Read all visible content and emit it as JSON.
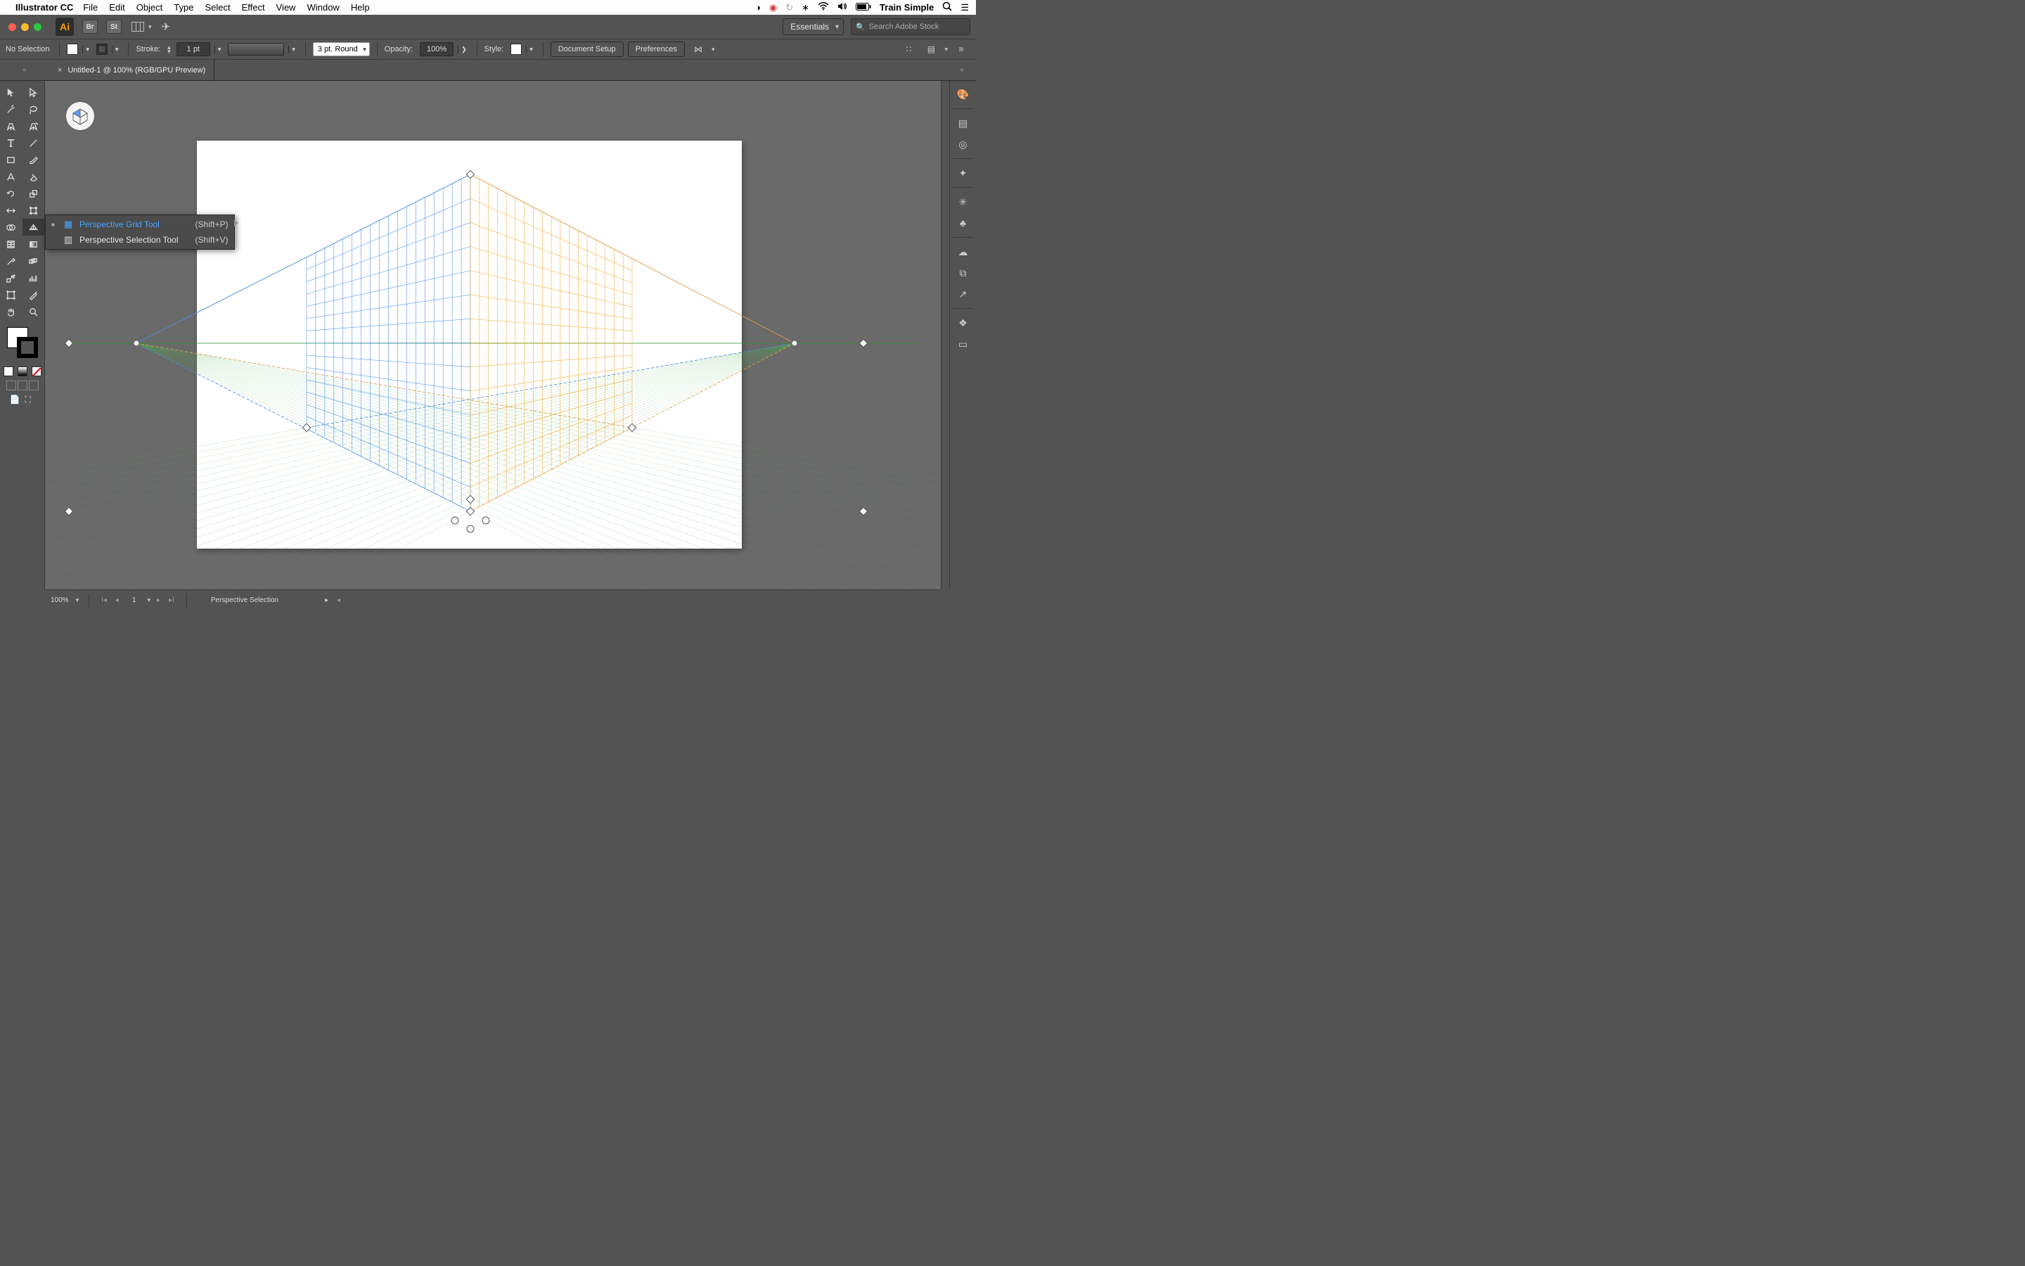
{
  "mac_menu": {
    "app": "Illustrator CC",
    "items": [
      "File",
      "Edit",
      "Object",
      "Type",
      "Select",
      "Effect",
      "View",
      "Window",
      "Help"
    ],
    "user": "Train Simple"
  },
  "workspace_label": "Essentials",
  "search_placeholder": "Search Adobe Stock",
  "control": {
    "selection_state": "No Selection",
    "stroke_label": "Stroke:",
    "stroke_value": "1 pt",
    "profile": "3 pt. Round",
    "opacity_label": "Opacity:",
    "opacity_value": "100%",
    "style_label": "Style:",
    "doc_setup": "Document Setup",
    "preferences": "Preferences"
  },
  "doc_tab": {
    "title": "Untitled-1 @ 100% (RGB/GPU Preview)"
  },
  "flyout": {
    "items": [
      {
        "label": "Perspective Grid Tool",
        "shortcut": "(Shift+P)",
        "selected": true
      },
      {
        "label": "Perspective Selection Tool",
        "shortcut": "(Shift+V)",
        "selected": false
      }
    ]
  },
  "status": {
    "zoom": "100%",
    "artboard_num": "1",
    "info": "Perspective Selection"
  }
}
